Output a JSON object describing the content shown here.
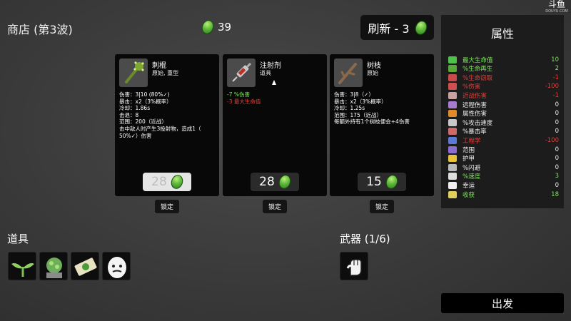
{
  "header": {
    "title": "商店 (第3波)",
    "materials": "39",
    "reroll_label": "刷新 - 3"
  },
  "watermark": {
    "glyph": "斗鱼",
    "sub": "DOUYU.COM"
  },
  "stats": {
    "title": "属性",
    "rows": [
      {
        "icon": "heart-icon",
        "label": "最大生命值",
        "value": "10",
        "color": "#7de85a",
        "icon_color": "#4ec24a"
      },
      {
        "icon": "regen-icon",
        "label": "%生命再生",
        "value": "2",
        "color": "#7de85a",
        "icon_color": "#59a83a"
      },
      {
        "icon": "lifesteal-icon",
        "label": "%生命窃取",
        "value": "-1",
        "color": "#e0403a",
        "icon_color": "#c84a4a"
      },
      {
        "icon": "damage-icon",
        "label": "%伤害",
        "value": "-100",
        "color": "#e0403a",
        "icon_color": "#d05050"
      },
      {
        "icon": "melee-icon",
        "label": "近战伤害",
        "value": "-1",
        "color": "#e0403a",
        "icon_color": "#c9a0a0"
      },
      {
        "icon": "ranged-icon",
        "label": "远程伤害",
        "value": "0",
        "color": "#f0f0f0",
        "icon_color": "#a67ccf"
      },
      {
        "icon": "elemental-icon",
        "label": "属性伤害",
        "value": "0",
        "color": "#f0f0f0",
        "icon_color": "#e08a2a"
      },
      {
        "icon": "attack-speed-icon",
        "label": "%攻击速度",
        "value": "0",
        "color": "#f0f0f0",
        "icon_color": "#c9c9c9"
      },
      {
        "icon": "crit-icon",
        "label": "%暴击率",
        "value": "0",
        "color": "#f0f0f0",
        "icon_color": "#cf6a6a"
      },
      {
        "icon": "engineering-icon",
        "label": "工程学",
        "value": "-100",
        "color": "#e0403a",
        "icon_color": "#5b7bd6"
      },
      {
        "icon": "range-icon",
        "label": "范围",
        "value": "0",
        "color": "#f0f0f0",
        "icon_color": "#8a6fd0"
      },
      {
        "icon": "armor-icon",
        "label": "护甲",
        "value": "0",
        "color": "#f0f0f0",
        "icon_color": "#e8c23a"
      },
      {
        "icon": "dodge-icon",
        "label": "%闪避",
        "value": "0",
        "color": "#f0f0f0",
        "icon_color": "#bbbbbb"
      },
      {
        "icon": "speed-icon",
        "label": "%速度",
        "value": "3",
        "color": "#7de85a",
        "icon_color": "#dddddd"
      },
      {
        "icon": "luck-icon",
        "label": "幸运",
        "value": "0",
        "color": "#f0f0f0",
        "icon_color": "#f0f0f0"
      },
      {
        "icon": "harvest-icon",
        "label": "收获",
        "value": "18",
        "color": "#7de85a",
        "icon_color": "#e0cf5a"
      }
    ]
  },
  "shop": {
    "lock_label": "锁定",
    "items": [
      {
        "name": "刺棍",
        "type": "原始, 重型",
        "price": "28",
        "price_style": "light",
        "lines": [
          "伤害：3|10 (80%✓)",
          "暴击：x2（3%概率）",
          "冷却：1.86s",
          "击退：8",
          "范围：200（近战）",
          "击中敌人时产生3投射物，造成1（",
          "50%✓）伤害"
        ]
      },
      {
        "name": "注射剂",
        "type": "道具",
        "price": "28",
        "price_style": "dark",
        "lines": [
          "-7 %伤害",
          "-3 最大生命值"
        ]
      },
      {
        "name": "树枝",
        "type": "原始",
        "price": "15",
        "price_style": "dark",
        "lines": [
          "伤害：3|8（✓）",
          "暴击：x2（3%概率）",
          "冷却：1.25s",
          "范围：175（近战）",
          "每额外持有1个树枝便会+4伤害"
        ]
      }
    ]
  },
  "items_section": {
    "label": "道具"
  },
  "weapons_section": {
    "label": "武器 (1/6)"
  },
  "go_label": "出发"
}
